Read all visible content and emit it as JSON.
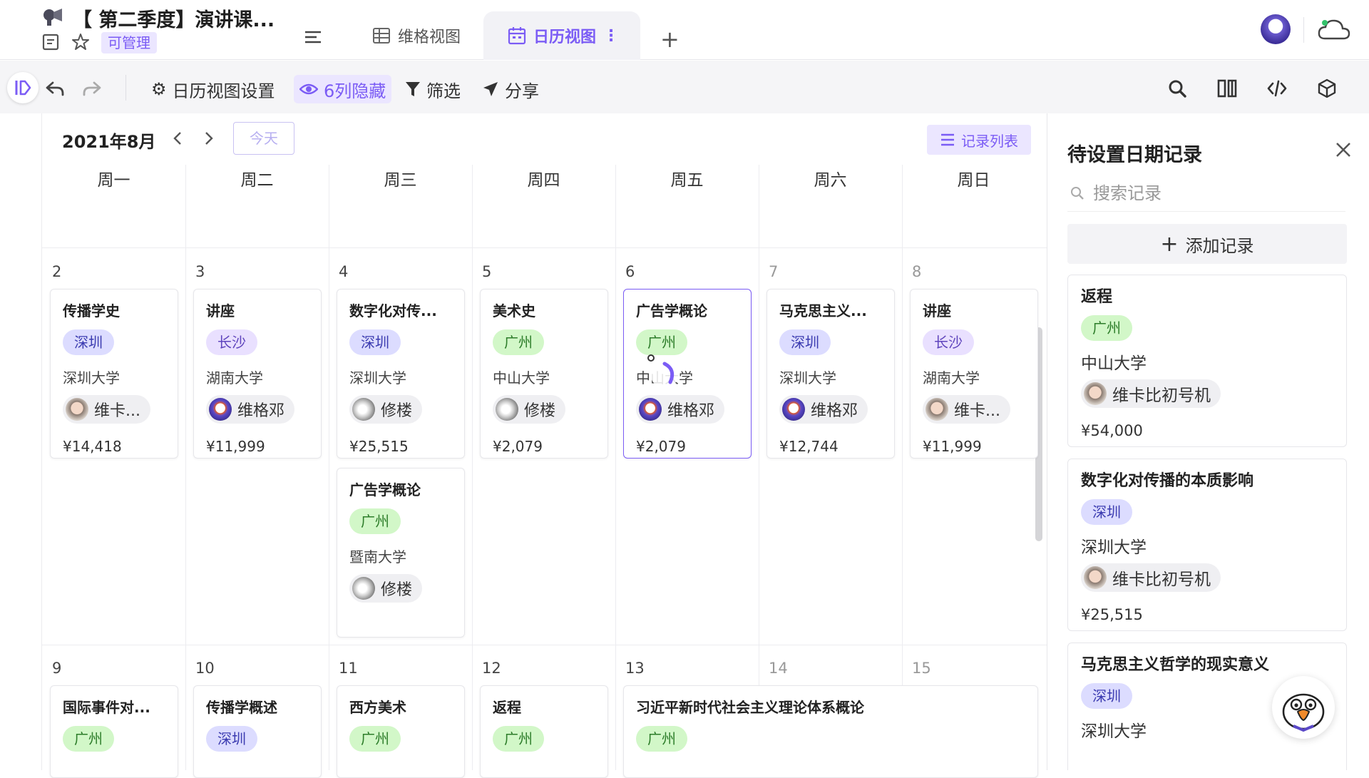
{
  "header": {
    "doc_title": "【 第二季度】演讲课...",
    "permission_badge": "可管理",
    "tabs": [
      {
        "label": "维格视图"
      },
      {
        "label": "日历视图"
      }
    ],
    "add_tab": "+"
  },
  "toolbar": {
    "calendar_settings": "日历视图设置",
    "hidden_columns": "6列隐藏",
    "filter": "筛选",
    "share": "分享"
  },
  "calendar": {
    "month": "2021年8月",
    "today_button": "今天",
    "record_list_button": "记录列表",
    "weekdays": [
      "周一",
      "周二",
      "周三",
      "周四",
      "周五",
      "周六",
      "周日"
    ],
    "week1": [
      "2",
      "3",
      "4",
      "5",
      "6",
      "7",
      "8"
    ],
    "week2": [
      "9",
      "10",
      "11",
      "12",
      "13",
      "14",
      "15"
    ],
    "events": [
      {
        "title": "传播学史",
        "city": "深圳",
        "school": "深圳大学",
        "person": "维卡...",
        "price": "¥14,418"
      },
      {
        "title": "讲座",
        "city": "长沙",
        "school": "湖南大学",
        "person": "维格邓",
        "price": "¥11,999"
      },
      {
        "title": "数字化对传...",
        "city": "深圳",
        "school": "深圳大学",
        "person": "修楼",
        "price": "¥25,515"
      },
      {
        "title": "美术史",
        "city": "广州",
        "school": "中山大学",
        "person": "修楼",
        "price": "¥2,079"
      },
      {
        "title": "广告学概论",
        "city": "广州",
        "school": "中山大学",
        "person": "维格邓",
        "price": "¥2,079"
      },
      {
        "title": "马克思主义...",
        "city": "深圳",
        "school": "深圳大学",
        "person": "维格邓",
        "price": "¥12,744"
      },
      {
        "title": "讲座",
        "city": "长沙",
        "school": "湖南大学",
        "person": "维卡...",
        "price": "¥11,999"
      },
      {
        "title": "广告学概论",
        "city": "广州",
        "school": "暨南大学",
        "person": "修楼"
      },
      {
        "title": "国际事件对...",
        "city": "广州"
      },
      {
        "title": "传播学概述",
        "city": "深圳"
      },
      {
        "title": "西方美术",
        "city": "广州"
      },
      {
        "title": "返程",
        "city": "广州"
      },
      {
        "title": "习近平新时代社会主义理论体系概论",
        "city": "广州"
      }
    ]
  },
  "right_panel": {
    "title": "待设置日期记录",
    "search_placeholder": "搜索记录",
    "add_record": "添加记录",
    "records": [
      {
        "title": "返程",
        "city": "广州",
        "school": "中山大学",
        "person": "维卡比初号机",
        "price": "¥54,000"
      },
      {
        "title": "数字化对传播的本质影响",
        "city": "深圳",
        "school": "深圳大学",
        "person": "维卡比初号机",
        "price": "¥25,515"
      },
      {
        "title": "马克思主义哲学的现实意义",
        "city": "深圳",
        "school": "深圳大学"
      }
    ]
  },
  "colors": {
    "accent": "#7b5cf5",
    "tag_shenzhen_bg": "#dcdcff",
    "tag_guangzhou_bg": "#d2f7c8",
    "tag_changsha_bg": "#e9e0ff"
  }
}
